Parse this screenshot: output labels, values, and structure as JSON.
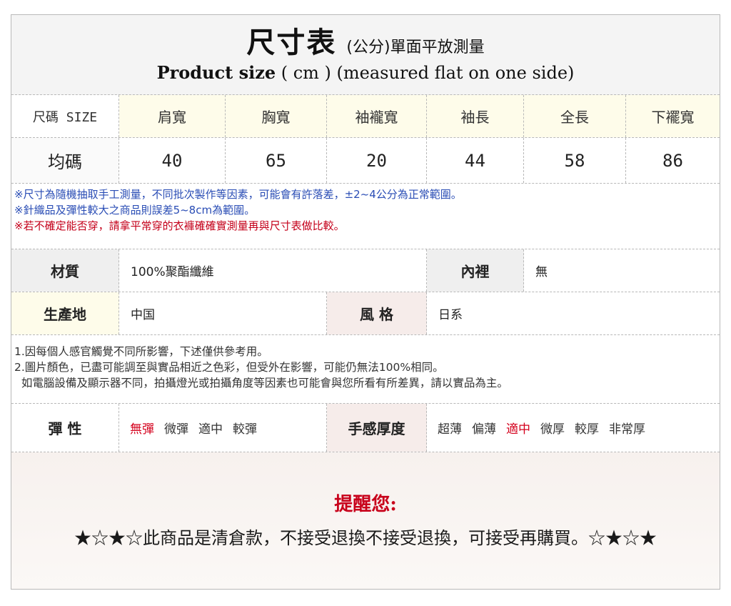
{
  "title": {
    "zh_main": "尺寸表",
    "zh_sub": "(公分)單面平放測量",
    "en_bold": "Product size",
    "en_rest": " ( cm ) (measured flat on one side)"
  },
  "size_table": {
    "headers": [
      "尺碼 SIZE",
      "肩寬",
      "胸寬",
      "袖襱寬",
      "袖長",
      "全長",
      "下襬寬"
    ],
    "row": [
      "均碼",
      "40",
      "65",
      "20",
      "44",
      "58",
      "86"
    ]
  },
  "notes": [
    "※尺寸為隨機抽取手工測量，不同批次製作等因素，可能會有許落差，±2~4公分為正常範圍。",
    "※針織品及彈性較大之商品則誤差5~8cm為範圍。",
    "※若不確定能否穿，請拿平常穿的衣褲確確實測量再與尺寸表做比較。"
  ],
  "material": {
    "label": "材質",
    "value": "100%聚酯纖維"
  },
  "lining": {
    "label": "內裡",
    "value": "無"
  },
  "origin": {
    "label": "生產地",
    "value": "中国"
  },
  "style": {
    "label": "風 格",
    "value": "日系"
  },
  "disclaimer": [
    "1.因每個人感官觸覺不同所影響，下述僅供參考用。",
    "2.圖片顏色，已盡可能調至與實品相近之色彩，但受外在影響，可能仍無法100%相同。",
    "  如電腦設備及顯示器不同，拍攝燈光或拍攝角度等因素也可能會與您所看有所差異，請以實品為主。"
  ],
  "elasticity": {
    "label": "彈 性",
    "options": [
      "無彈",
      "微彈",
      "適中",
      "較彈"
    ],
    "selected": "無彈"
  },
  "thickness": {
    "label": "手感厚度",
    "options": [
      "超薄",
      "偏薄",
      "適中",
      "微厚",
      "較厚",
      "非常厚"
    ],
    "selected": "適中"
  },
  "reminder": {
    "title": "提醒您:",
    "text": "★☆★☆此商品是清倉款，不接受退換不接受退換，可接受再購買。☆★☆★"
  },
  "colors": {
    "accent_red": "#d4001c",
    "notes_blue": "#2a4db5",
    "header_cream": "#fefcea"
  }
}
